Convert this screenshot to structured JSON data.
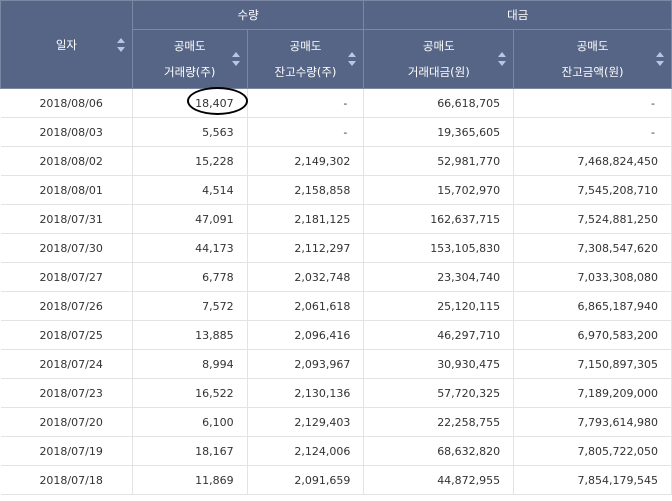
{
  "header": {
    "date_col": "일자",
    "group_volume": "수량",
    "group_amount": "대금",
    "cols": [
      {
        "line1": "공매도",
        "line2": "거래량(주)"
      },
      {
        "line1": "공매도",
        "line2": "잔고수량(주)"
      },
      {
        "line1": "공매도",
        "line2": "거래대금(원)"
      },
      {
        "line1": "공매도",
        "line2": "잔고금액(원)"
      }
    ]
  },
  "rows": [
    {
      "date": "2018/08/06",
      "vol": "18,407",
      "bal_qty": "-",
      "amount": "66,618,705",
      "bal_amt": "-"
    },
    {
      "date": "2018/08/03",
      "vol": "5,563",
      "bal_qty": "-",
      "amount": "19,365,605",
      "bal_amt": "-"
    },
    {
      "date": "2018/08/02",
      "vol": "15,228",
      "bal_qty": "2,149,302",
      "amount": "52,981,770",
      "bal_amt": "7,468,824,450"
    },
    {
      "date": "2018/08/01",
      "vol": "4,514",
      "bal_qty": "2,158,858",
      "amount": "15,702,970",
      "bal_amt": "7,545,208,710"
    },
    {
      "date": "2018/07/31",
      "vol": "47,091",
      "bal_qty": "2,181,125",
      "amount": "162,637,715",
      "bal_amt": "7,524,881,250"
    },
    {
      "date": "2018/07/30",
      "vol": "44,173",
      "bal_qty": "2,112,297",
      "amount": "153,105,830",
      "bal_amt": "7,308,547,620"
    },
    {
      "date": "2018/07/27",
      "vol": "6,778",
      "bal_qty": "2,032,748",
      "amount": "23,304,740",
      "bal_amt": "7,033,308,080"
    },
    {
      "date": "2018/07/26",
      "vol": "7,572",
      "bal_qty": "2,061,618",
      "amount": "25,120,115",
      "bal_amt": "6,865,187,940"
    },
    {
      "date": "2018/07/25",
      "vol": "13,885",
      "bal_qty": "2,096,416",
      "amount": "46,297,710",
      "bal_amt": "6,970,583,200"
    },
    {
      "date": "2018/07/24",
      "vol": "8,994",
      "bal_qty": "2,093,967",
      "amount": "30,930,475",
      "bal_amt": "7,150,897,305"
    },
    {
      "date": "2018/07/23",
      "vol": "16,522",
      "bal_qty": "2,130,136",
      "amount": "57,720,325",
      "bal_amt": "7,189,209,000"
    },
    {
      "date": "2018/07/20",
      "vol": "6,100",
      "bal_qty": "2,129,403",
      "amount": "22,258,755",
      "bal_amt": "7,793,614,980"
    },
    {
      "date": "2018/07/19",
      "vol": "18,167",
      "bal_qty": "2,124,006",
      "amount": "68,632,820",
      "bal_amt": "7,805,722,050"
    },
    {
      "date": "2018/07/18",
      "vol": "11,869",
      "bal_qty": "2,091,659",
      "amount": "44,872,955",
      "bal_amt": "7,854,179,545"
    }
  ],
  "colors": {
    "header_bg": "#566585",
    "header_text": "#ffffff",
    "grid_line": "#e3e3e3",
    "highlight_circle": "#000000"
  }
}
